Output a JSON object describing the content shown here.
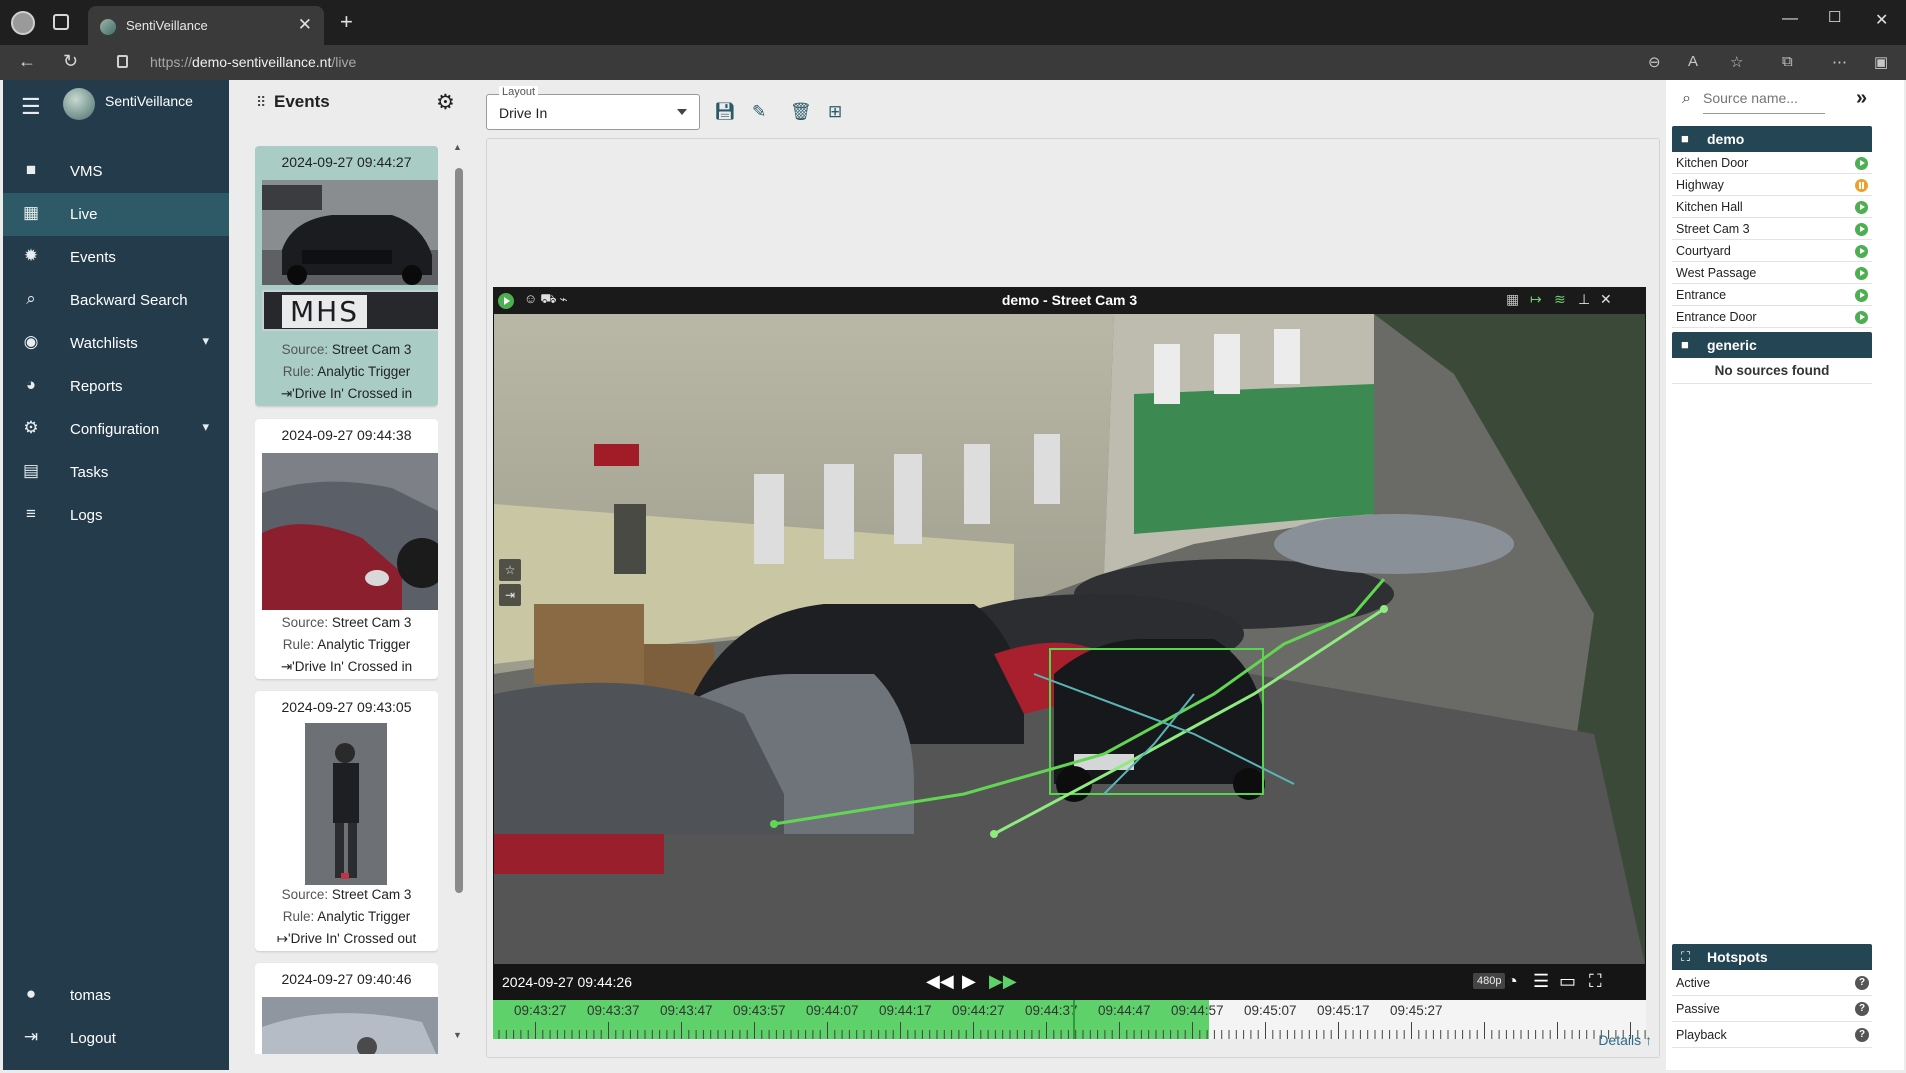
{
  "browser": {
    "tab_title": "SentiVeillance",
    "url_prefix": "https://",
    "url_host": "demo-sentiveillance.nt",
    "url_path": "/live"
  },
  "app": {
    "brand": "SentiVeillance",
    "accent_color": "#2d5a66",
    "sidebar_color": "#243b4c",
    "nav": [
      {
        "label": "VMS",
        "icon": "video-camera-icon"
      },
      {
        "label": "Live",
        "icon": "dashboard-icon",
        "active": true
      },
      {
        "label": "Events",
        "icon": "aperture-icon"
      },
      {
        "label": "Backward Search",
        "icon": "search-history-icon"
      },
      {
        "label": "Watchlists",
        "icon": "eye-icon",
        "expandable": true
      },
      {
        "label": "Reports",
        "icon": "pie-chart-icon"
      },
      {
        "label": "Configuration",
        "icon": "gear-icon",
        "expandable": true
      },
      {
        "label": "Tasks",
        "icon": "clipboard-icon"
      },
      {
        "label": "Logs",
        "icon": "list-icon"
      }
    ],
    "user": "tomas",
    "logout": "Logout"
  },
  "events": {
    "title": "Events",
    "source_prefix": "Source:",
    "rule_prefix": "Rule:",
    "items": [
      {
        "time": "2024-09-27 09:44:27",
        "source": "Street Cam 3",
        "rule": "Analytic Trigger",
        "detail": "'Drive In' Crossed in",
        "plate": "MHS"
      },
      {
        "time": "2024-09-27 09:44:38",
        "source": "Street Cam 3",
        "rule": "Analytic Trigger",
        "detail": "'Drive In' Crossed in"
      },
      {
        "time": "2024-09-27 09:43:05",
        "source": "Street Cam 3",
        "rule": "Analytic Trigger",
        "detail": "'Drive In' Crossed out"
      },
      {
        "time": "2024-09-27 09:40:46"
      }
    ]
  },
  "main": {
    "layout_legend": "Layout",
    "layout_value": "Drive In",
    "camera": {
      "title": "demo - Street Cam 3",
      "timestamp": "2024-09-27 09:44:26",
      "resolution": "480p",
      "plate_overlay": "MHS"
    },
    "timeline": {
      "labels": [
        "09:43:27",
        "09:43:37",
        "09:43:47",
        "09:43:57",
        "09:44:07",
        "09:44:17",
        "09:44:27",
        "09:44:37",
        "09:44:47",
        "09:44:57",
        "09:45:07",
        "09:45:17",
        "09:45:27"
      ],
      "played_color": "#5fd16a"
    },
    "details_label": "Details"
  },
  "sources": {
    "search_placeholder": "Source name...",
    "groups": [
      {
        "name": "demo",
        "items": [
          {
            "name": "Kitchen Door",
            "status": "live"
          },
          {
            "name": "Highway",
            "status": "paused"
          },
          {
            "name": "Kitchen Hall",
            "status": "live"
          },
          {
            "name": "Street Cam 3",
            "status": "live"
          },
          {
            "name": "Courtyard",
            "status": "live"
          },
          {
            "name": "West Passage",
            "status": "live"
          },
          {
            "name": "Entrance",
            "status": "live"
          },
          {
            "name": "Entrance Door",
            "status": "live"
          }
        ]
      },
      {
        "name": "generic",
        "empty_text": "No sources found"
      }
    ],
    "hotspots": {
      "title": "Hotspots",
      "items": [
        "Active",
        "Passive",
        "Playback"
      ]
    }
  }
}
